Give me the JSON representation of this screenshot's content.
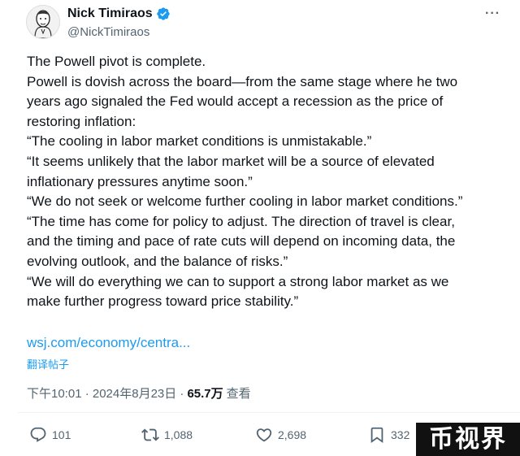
{
  "author": {
    "display_name": "Nick Timiraos",
    "handle": "@NickTimiraos",
    "avatar_icon": "avatar-sketch-icon",
    "verified_icon": "verified-badge-icon",
    "verified_color": "#1d9bf0"
  },
  "menu": {
    "more_label": "···"
  },
  "tweet": {
    "lines": [
      "The Powell pivot is complete.",
      "Powell is dovish across the board—from the same stage where he two",
      "years ago signaled the Fed would accept a recession as the price of",
      "restoring inflation:",
      "“The cooling in labor market conditions is unmistakable.”",
      "“It seems unlikely that the labor market will be a source of elevated",
      "inflationary pressures anytime soon.”",
      "“We do not seek or welcome further cooling in labor market conditions.”",
      "“The time has come for policy to adjust. The direction of travel is clear,",
      "and the timing and pace of rate cuts will depend on incoming data, the",
      "evolving outlook, and the balance of risks.”",
      "“We will do everything we can to support a strong labor market as we",
      "make further progress toward price stability.”"
    ],
    "link_text": "wsj.com/economy/centra...",
    "translate_label": "翻译帖子",
    "timestamp": "下午10:01 · 2024年8月23日 ·",
    "views_count": "65.7万",
    "views_label": "查看"
  },
  "actions": {
    "reply_count": "101",
    "retweet_count": "1,088",
    "like_count": "2,698",
    "bookmark_count": "332"
  },
  "watermark": {
    "text": "币视界"
  },
  "colors": {
    "text": "#0f1419",
    "secondary": "#536471",
    "link": "#1d9bf0"
  }
}
